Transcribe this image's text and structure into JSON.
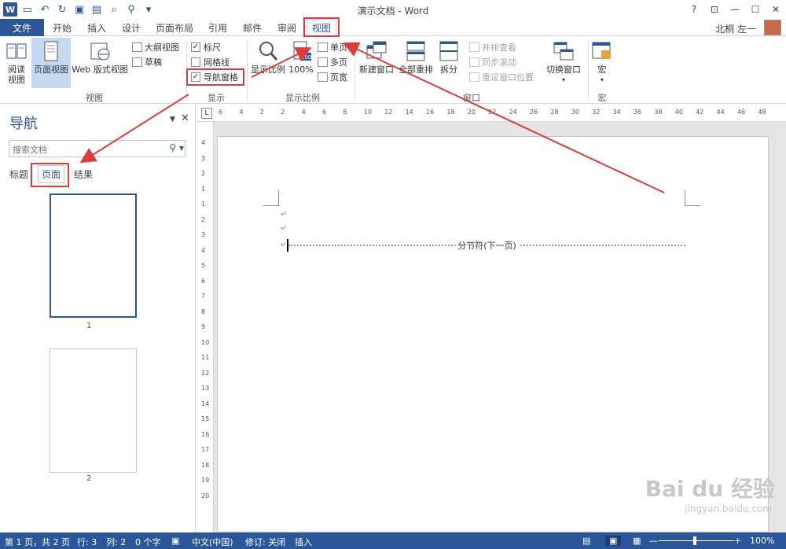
{
  "window": {
    "title": "演示文档 - Word",
    "user": "北桐 左一"
  },
  "tabs": [
    "文件",
    "开始",
    "插入",
    "设计",
    "页面布局",
    "引用",
    "邮件",
    "审阅",
    "视图"
  ],
  "active_tab": "视图",
  "ribbon": {
    "view_group": {
      "label": "视图",
      "read": "阅读\n视图",
      "page": "页面视图",
      "web": "Web 版式视图",
      "outline": "大纲视图",
      "draft": "草稿"
    },
    "show_group": {
      "label": "显示",
      "ruler": "标尺",
      "grid": "网格线",
      "navpane": "导航窗格"
    },
    "zoom_group": {
      "label": "显示比例",
      "zoom": "显示比例",
      "hundred": "100%",
      "onepage": "单页",
      "multipage": "多页",
      "pagewidth": "页宽"
    },
    "window_group": {
      "label": "窗口",
      "newwin": "新建窗口",
      "arrange": "全部重排",
      "split": "拆分",
      "sidebyside": "并排查看",
      "syncscroll": "同步滚动",
      "resetpos": "重设窗口位置",
      "switch": "切换窗口"
    },
    "macro_group": {
      "label": "宏",
      "macro": "宏"
    }
  },
  "nav": {
    "title": "导航",
    "search_placeholder": "搜索文档",
    "tabs": [
      "标题",
      "页面",
      "结果"
    ],
    "active_tab": "页面",
    "pages": [
      "1",
      "2"
    ]
  },
  "doc": {
    "section_break": "分节符(下一页)",
    "para_mark": "↵"
  },
  "ruler": {
    "h": [
      "6",
      "4",
      "2",
      "2",
      "4",
      "6",
      "8",
      "10",
      "12",
      "14",
      "16",
      "18",
      "20",
      "22",
      "24",
      "26",
      "28",
      "30",
      "32",
      "34",
      "36",
      "38",
      "40",
      "42",
      "44",
      "46",
      "48"
    ],
    "v": [
      "4",
      "3",
      "2",
      "1",
      "1",
      "2",
      "3",
      "4",
      "5",
      "6",
      "7",
      "8",
      "9",
      "10",
      "11",
      "12",
      "13",
      "14",
      "15",
      "16",
      "17",
      "18",
      "19",
      "20"
    ]
  },
  "status": {
    "page": "第 1 页，共 2 页",
    "row": "行: 3",
    "col": "列: 2",
    "words": "0 个字",
    "lang": "中文(中国)",
    "track": "修订: 关闭",
    "insert": "插入",
    "zoom": "100%"
  },
  "watermark": {
    "main": "Bai du 经验",
    "sub": "jingyan.baidu.com"
  },
  "colors": {
    "accent": "#2b579a",
    "highlight": "#e03b3b"
  }
}
